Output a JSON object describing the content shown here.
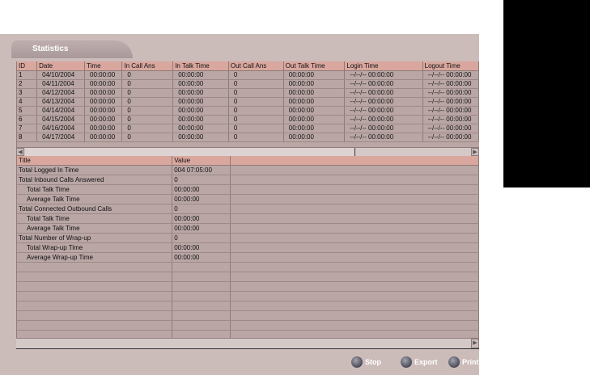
{
  "window": {
    "tab_title": "Statistics"
  },
  "daily_table": {
    "columns": [
      "ID",
      "Date",
      "Time",
      "In Call Ans",
      "In Talk Time",
      "Out Call Ans",
      "Out Talk Time",
      "Login Time",
      "Logout Time"
    ],
    "rows": [
      [
        "1",
        "04/10/2004",
        "00:00:00",
        "0",
        "00:00:00",
        "0",
        "00:00:00",
        "--/--/-- 00:00:00",
        "--/--/-- 00:00:00"
      ],
      [
        "2",
        "04/11/2004",
        "00:00:00",
        "0",
        "00:00:00",
        "0",
        "00:00:00",
        "--/--/-- 00:00:00",
        "--/--/-- 00:00:00"
      ],
      [
        "3",
        "04/12/2004",
        "00:00:00",
        "0",
        "00:00:00",
        "0",
        "00:00:00",
        "--/--/-- 00:00:00",
        "--/--/-- 00:00:00"
      ],
      [
        "4",
        "04/13/2004",
        "00:00:00",
        "0",
        "00:00:00",
        "0",
        "00:00:00",
        "--/--/-- 00:00:00",
        "--/--/-- 00:00:00"
      ],
      [
        "5",
        "04/14/2004",
        "00:00:00",
        "0",
        "00:00:00",
        "0",
        "00:00:00",
        "--/--/-- 00:00:00",
        "--/--/-- 00:00:00"
      ],
      [
        "6",
        "04/15/2004",
        "00:00:00",
        "0",
        "00:00:00",
        "0",
        "00:00:00",
        "--/--/-- 00:00:00",
        "--/--/-- 00:00:00"
      ],
      [
        "7",
        "04/16/2004",
        "00:00:00",
        "0",
        "00:00:00",
        "0",
        "00:00:00",
        "--/--/-- 00:00:00",
        "--/--/-- 00:00:00"
      ],
      [
        "8",
        "04/17/2004",
        "00:00:00",
        "0",
        "00:00:00",
        "0",
        "00:00:00",
        "--/--/-- 00:00:00",
        "--/--/-- 00:00:00"
      ]
    ]
  },
  "summary_table": {
    "columns": [
      "Title",
      "Value"
    ],
    "rows": [
      {
        "title": "Total Logged In Time",
        "value": "004 07:05:00",
        "indent": false
      },
      {
        "title": "Total Inbound Calls Answered",
        "value": "0",
        "indent": false
      },
      {
        "title": "Total Talk Time",
        "value": "00:00:00",
        "indent": true
      },
      {
        "title": "Average Talk Time",
        "value": "00:00:00",
        "indent": true
      },
      {
        "title": "Total Connected Outbound Calls",
        "value": "0",
        "indent": false
      },
      {
        "title": "Total Talk Time",
        "value": "00:00:00",
        "indent": true
      },
      {
        "title": "Average Talk Time",
        "value": "00:00:00",
        "indent": true
      },
      {
        "title": "Total Number of Wrap-up",
        "value": "0",
        "indent": false
      },
      {
        "title": "Total Wrap-up Time",
        "value": "00:00:00",
        "indent": true
      },
      {
        "title": "Average Wrap-up Time",
        "value": "00:00:00",
        "indent": true
      }
    ],
    "empty_rows": 9
  },
  "buttons": {
    "stop": "Stop",
    "export": "Export",
    "print": "Print"
  }
}
